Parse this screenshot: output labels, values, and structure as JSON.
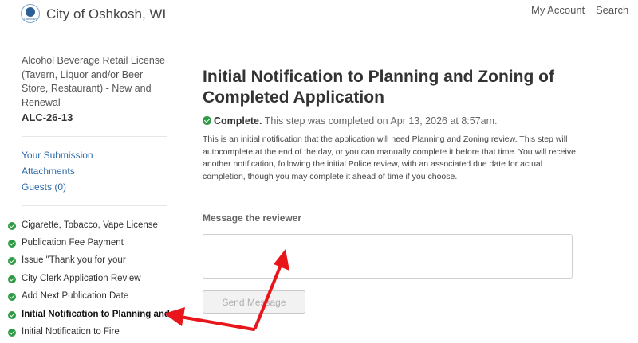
{
  "header": {
    "site_name": "City of Oshkosh, WI",
    "logo_caption": "Oshkosh",
    "nav": {
      "account": "My Account",
      "search": "Search"
    }
  },
  "sidebar": {
    "license_title": "Alcohol Beverage Retail License (Tavern, Liquor and/or Beer Store, Restaurant) - New and Renewal",
    "license_code": "ALC-26-13",
    "links": [
      {
        "label": "Your Submission"
      },
      {
        "label": "Attachments"
      },
      {
        "label": "Guests (0)"
      }
    ],
    "steps": [
      {
        "label": "Cigarette, Tobacco, Vape License",
        "status": "complete"
      },
      {
        "label": "Publication Fee Payment",
        "status": "complete"
      },
      {
        "label": "Issue \"Thank you for your",
        "status": "complete"
      },
      {
        "label": "City Clerk Application Review",
        "status": "complete"
      },
      {
        "label": "Add Next Publication Date",
        "status": "complete"
      },
      {
        "label": "Initial Notification to Planning and",
        "status": "complete",
        "active": true
      },
      {
        "label": "Initial Notification to Fire",
        "status": "complete"
      }
    ]
  },
  "main": {
    "title": "Initial Notification to Planning and Zoning of Completed Application",
    "status_label": "Complete.",
    "status_text": " This step was completed on Apr 13, 2026 at 8:57am.",
    "description": "This is an initial notification that the application will need Planning and Zoning review. This step will autocomplete at the end of the day, or you can manually complete it before that time. You will receive another notification, following the initial Police review, with an associated due date for actual completion, though you may complete it ahead of time if you choose.",
    "message_label": "Message the reviewer",
    "message_value": "",
    "send_button": "Send Message"
  },
  "colors": {
    "link": "#2d6aa8",
    "success": "#2e9a45",
    "annotation_arrow": "#e8161b"
  }
}
